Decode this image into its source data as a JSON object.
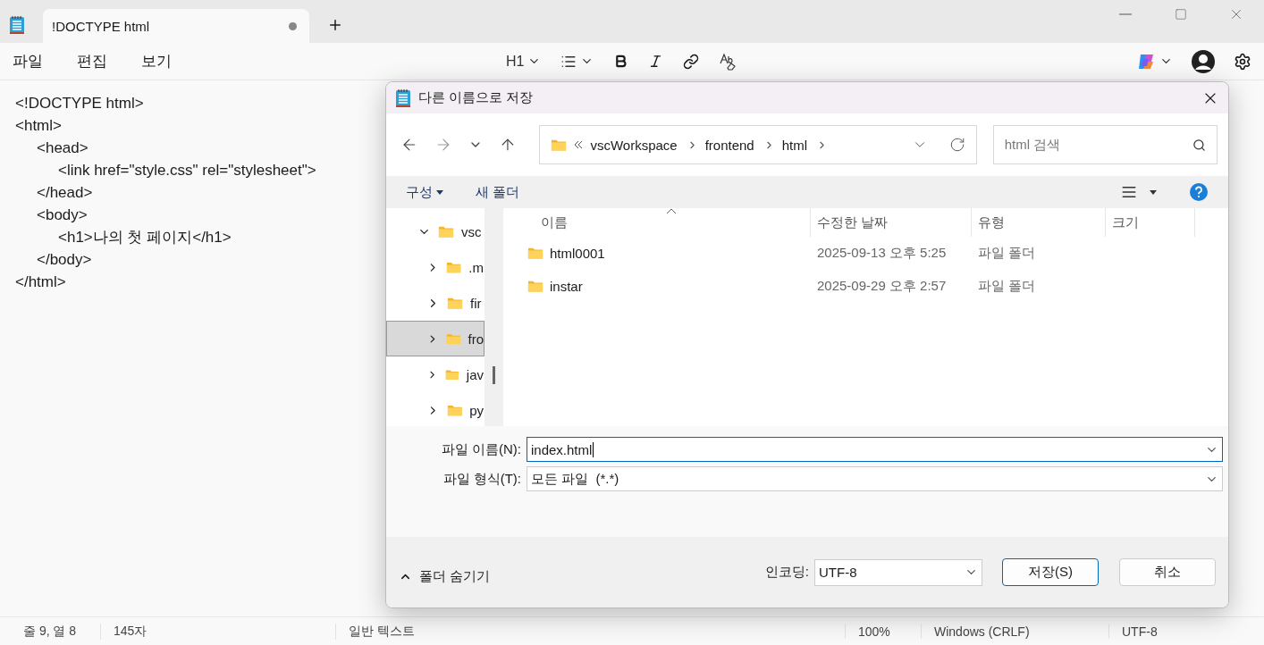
{
  "tabs": [
    {
      "label": "!DOCTYPE html",
      "selected": true,
      "modified": true
    }
  ],
  "menu": [
    "파일",
    "편집",
    "보기"
  ],
  "format_toolbar": {
    "heading": "H1"
  },
  "editor_lines": [
    "<!DOCTYPE html>",
    "<html>",
    "\t<head>",
    "\t\t<link href=\"style.css\" rel=\"stylesheet\">",
    "\t</head>",
    "\t<body>",
    "\t\t<h1>나의 첫 페이지</h1>",
    "\t</body>",
    "</html>"
  ],
  "dialog": {
    "title": "다른 이름으로 저장",
    "path": [
      "vscWorkspace",
      "frontend",
      "html"
    ],
    "search": {
      "placeholder": "html 검색"
    },
    "organize": "구성",
    "new_folder": "새 폴더",
    "tree": [
      {
        "label": "vsc",
        "expanded": true,
        "selected": false,
        "children": [
          {
            "label": ".m",
            "expanded": false,
            "selected": false
          },
          {
            "label": "fir",
            "expanded": false,
            "selected": false
          },
          {
            "label": "fro",
            "expanded": false,
            "selected": true
          },
          {
            "label": "jav",
            "expanded": false,
            "selected": false
          },
          {
            "label": "py",
            "expanded": false,
            "selected": false
          }
        ]
      }
    ],
    "columns": [
      "이름",
      "수정한 날짜",
      "유형",
      "크기"
    ],
    "rows": [
      {
        "name": "html0001",
        "modified": "2025-09-13 오후 5:25",
        "type": "파일 폴더"
      },
      {
        "name": "instar",
        "modified": "2025-09-29 오후 2:57",
        "type": "파일 폴더"
      }
    ],
    "file_name": {
      "label": "파일 이름(N):",
      "value": "index.html"
    },
    "file_type": {
      "label": "파일 형식(T):",
      "value": "모든 파일  (*.*)"
    },
    "hide_folders": "폴더 숨기기",
    "encoding": {
      "label": "인코딩:",
      "value": "UTF-8"
    },
    "buttons": [
      "저장(S)",
      "취소"
    ]
  },
  "status_bar": [
    "줄 9, 열 8",
    "145자",
    "일반 텍스트",
    "100%",
    "Windows (CRLF)",
    "UTF-8"
  ]
}
